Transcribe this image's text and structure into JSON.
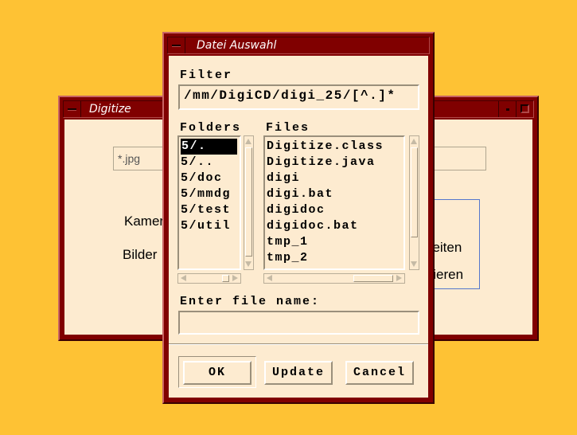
{
  "digitize": {
    "title": "Digitize",
    "pattern_value": "*.jpg",
    "label_kamera": "Kamer",
    "label_bilder": "Bilder",
    "btn_bearbeiten_partial": "beiten",
    "btn_korrigieren_partial": "igieren"
  },
  "dialog": {
    "title": "Datei Auswahl",
    "filter_label": "Filter",
    "filter_value": "/mm/DigiCD/digi_25/[^.]*",
    "folders_label": "Folders",
    "files_label": "Files",
    "folders": [
      "5/.",
      "5/..",
      "5/doc",
      "5/mmdg",
      "5/test",
      "5/util"
    ],
    "selected_folder": "5/.",
    "files": [
      "Digitize.class",
      "Digitize.java",
      "digi",
      "digi.bat",
      "digidoc",
      "digidoc.bat",
      "tmp_1",
      "tmp_2"
    ],
    "filename_label": "Enter file name:",
    "filename_value": "",
    "ok_label": "OK",
    "update_label": "Update",
    "cancel_label": "Cancel"
  },
  "colors": {
    "desktop": "#fec234",
    "titlebar": "#800000",
    "client": "#fdebd0"
  }
}
